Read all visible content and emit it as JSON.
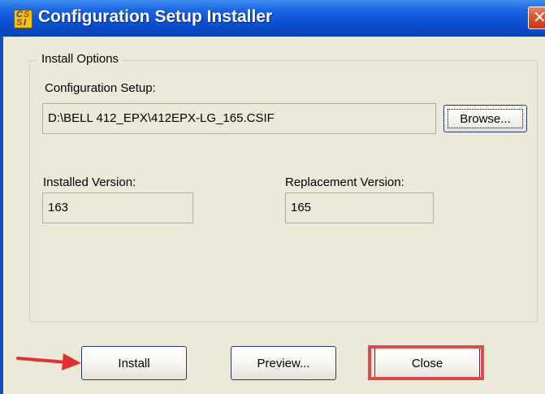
{
  "window": {
    "title": "Configuration Setup Installer",
    "icon": "csi-app-icon",
    "close_glyph": "✕"
  },
  "group": {
    "label": "Install Options"
  },
  "config": {
    "label": "Configuration Setup:",
    "value": "D:\\BELL 412_EPX\\412EPX-LG_165.CSIF",
    "browse_label": "Browse..."
  },
  "installed": {
    "label": "Installed Version:",
    "value": "163"
  },
  "replacement": {
    "label": "Replacement Version:",
    "value": "165"
  },
  "buttons": {
    "install": "Install",
    "preview": "Preview...",
    "close": "Close"
  },
  "annotations": {
    "arrow_color": "#e03030",
    "highlight_color": "#e04a4a"
  }
}
